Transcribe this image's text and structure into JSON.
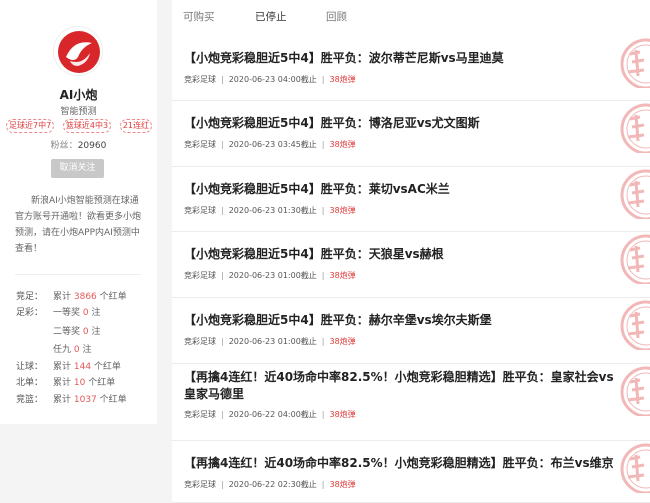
{
  "profile": {
    "name": "AI小炮",
    "subtitle": "智能预测",
    "badges": [
      "足球近7中7",
      "篮球近4中3",
      "21连红"
    ],
    "fans_label": "粉丝：",
    "fans_count": "20960",
    "unfollow_label": "取消关注",
    "description": "新浪AI小炮智能预测在球通官方账号开通啦！欲看更多小炮预测，请在小炮APP内AI预测中查看！"
  },
  "stats": [
    {
      "label": "竞足：",
      "prefix": "累计 ",
      "num": "3866",
      "suffix": " 个红单"
    },
    {
      "label": "足彩：",
      "prefix": "一等奖 ",
      "num": "0",
      "suffix": " 注"
    },
    {
      "label": "",
      "prefix": "二等奖 ",
      "num": "0",
      "suffix": " 注"
    },
    {
      "label": "",
      "prefix": "任九 ",
      "num": "0",
      "suffix": " 注"
    },
    {
      "label": "让球：",
      "prefix": "累计 ",
      "num": "144",
      "suffix": " 个红单"
    },
    {
      "label": "北单：",
      "prefix": "累计 ",
      "num": "10",
      "suffix": " 个红单"
    },
    {
      "label": "竞篮：",
      "prefix": "累计 ",
      "num": "1037",
      "suffix": " 个红单"
    }
  ],
  "tabs": [
    "可购买",
    "已停止",
    "回顾"
  ],
  "active_tab": 1,
  "items": [
    {
      "title": "【小炮竞彩稳胆近5中4】胜平负：波尔蒂芒尼斯vs马里迪莫",
      "category": "竞彩足球",
      "time": "2020-06-23 04:00截止",
      "price": "38炮弹"
    },
    {
      "title": "【小炮竞彩稳胆近5中4】胜平负：博洛尼亚vs尤文图斯",
      "category": "竞彩足球",
      "time": "2020-06-23 03:45截止",
      "price": "38炮弹"
    },
    {
      "title": "【小炮竞彩稳胆近5中4】胜平负：莱切vsAC米兰",
      "category": "竞彩足球",
      "time": "2020-06-23 01:30截止",
      "price": "38炮弹"
    },
    {
      "title": "【小炮竞彩稳胆近5中4】胜平负：天狼星vs赫根",
      "category": "竞彩足球",
      "time": "2020-06-23 01:00截止",
      "price": "38炮弹"
    },
    {
      "title": "【小炮竞彩稳胆近5中4】胜平负：赫尔辛堡vs埃尔夫斯堡",
      "category": "竞彩足球",
      "time": "2020-06-23 01:00截止",
      "price": "38炮弹"
    },
    {
      "title": "【再擒4连红！近40场命中率82.5%！小炮竞彩稳胆精选】胜平负：皇家社会vs皇家马德里",
      "category": "竞彩足球",
      "time": "2020-06-22 04:00截止",
      "price": "38炮弹"
    },
    {
      "title": "【再擒4连红！近40场命中率82.5%！小炮竞彩稳胆精选】胜平负：布兰vs维京",
      "category": "竞彩足球",
      "time": "2020-06-22 02:30截止",
      "price": "38炮弹"
    }
  ],
  "colors": {
    "accent_red": "#e03a3a",
    "stamp_red": "#f2b8b8",
    "button_gray": "#c8c8c8"
  }
}
